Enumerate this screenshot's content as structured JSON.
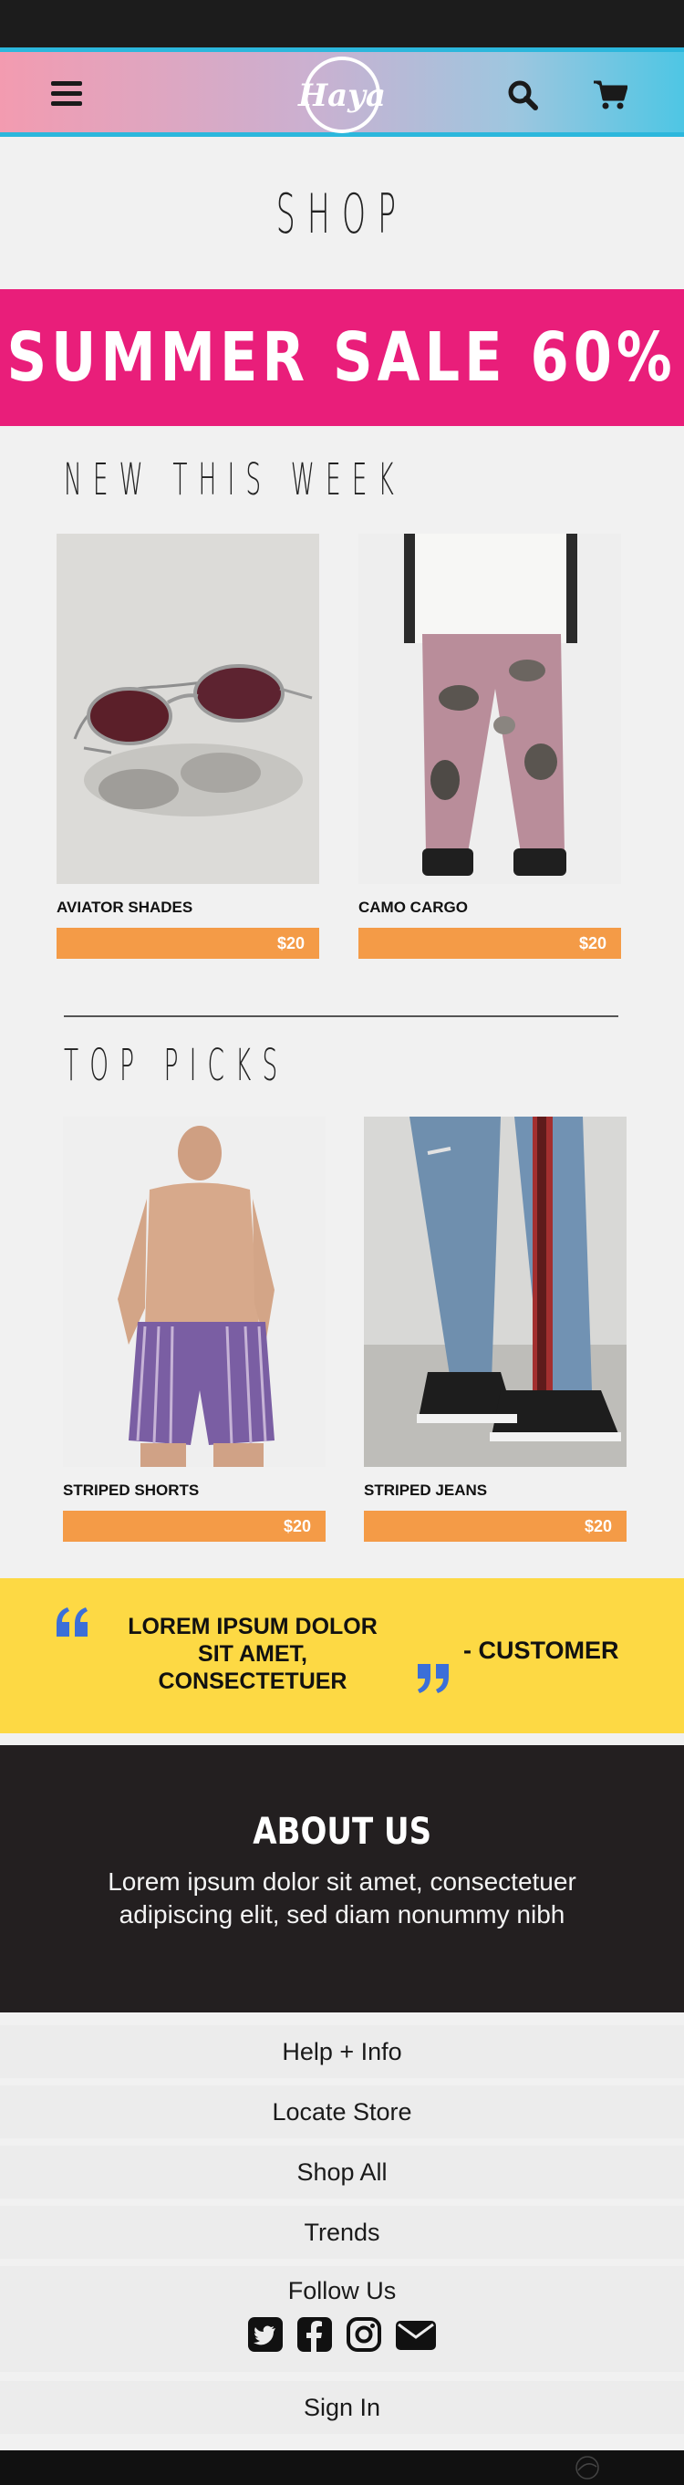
{
  "header": {
    "logo_text": "Haya",
    "menu_icon": "hamburger-menu-icon",
    "search_icon": "search-icon",
    "cart_icon": "shopping-cart-icon"
  },
  "page_title": "SHOP",
  "sale_banner": "SUMMER SALE 60%",
  "new_this_week": {
    "title": "NEW THIS WEEK",
    "products": [
      {
        "name": "AVIATOR SHADES",
        "price": "$20"
      },
      {
        "name": "CAMO CARGO",
        "price": "$20"
      }
    ]
  },
  "top_picks": {
    "title": "TOP PICKS",
    "products": [
      {
        "name": "STRIPED SHORTS",
        "price": "$20"
      },
      {
        "name": "STRIPED JEANS",
        "price": "$20"
      }
    ]
  },
  "testimonial": {
    "text": "LOREM IPSUM DOLOR SIT AMET, CONSECTETUER",
    "author": "- CUSTOMER"
  },
  "about": {
    "title": "ABOUT US",
    "body": "Lorem ipsum dolor sit amet, consectetuer adipiscing elit, sed diam nonummy nibh"
  },
  "footer": {
    "help": "Help + Info",
    "locate": "Locate Store",
    "shop_all": "Shop All",
    "trends": "Trends",
    "follow": "Follow Us",
    "sign_in": "Sign In",
    "socials": [
      "twitter-icon",
      "facebook-icon",
      "instagram-icon",
      "email-icon"
    ]
  },
  "colors": {
    "sale": "#e91e7a",
    "price": "#f49b47",
    "quote_bg": "#fdd944",
    "quote_mark": "#3b6fd8",
    "about_bg": "#231f20",
    "header_accent": "#2cb7dc"
  }
}
